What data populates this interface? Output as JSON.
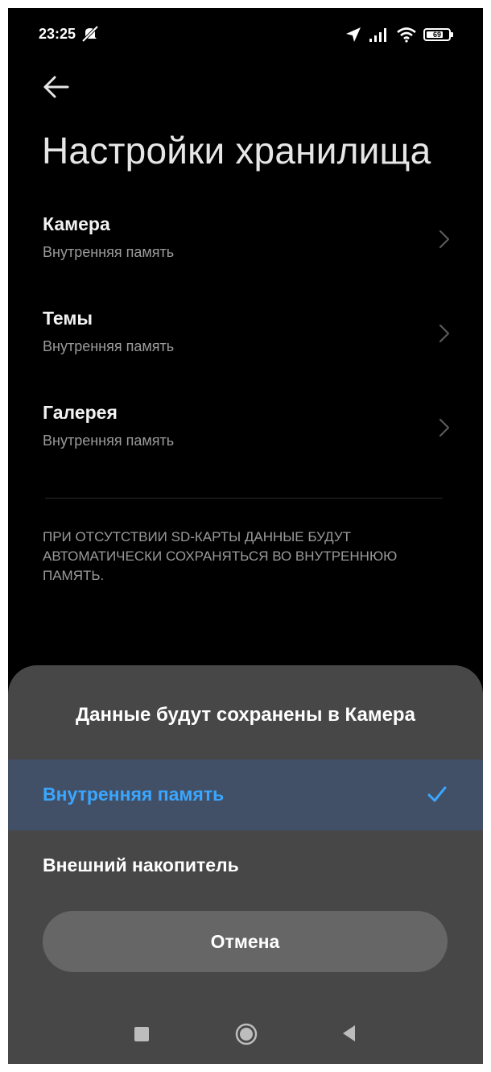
{
  "status_bar": {
    "time": "23:25",
    "battery": "69",
    "icons": [
      "mute-icon",
      "location-arrow-icon",
      "signal-icon",
      "wifi-icon",
      "battery-icon"
    ]
  },
  "header": {
    "back_icon": "arrow-left-icon",
    "title": "Настройки хранилища"
  },
  "settings": [
    {
      "label": "Камера",
      "value": "Внутренняя память"
    },
    {
      "label": "Темы",
      "value": "Внутренняя память"
    },
    {
      "label": "Галерея",
      "value": "Внутренняя память"
    }
  ],
  "note": "При отсутствии SD-карты данные будут автоматически сохраняться во внутреннюю память.",
  "sheet": {
    "title": "Данные будут сохранены в Камера",
    "options": [
      {
        "label": "Внутренняя память",
        "selected": true
      },
      {
        "label": "Внешний накопитель",
        "selected": false
      }
    ],
    "cancel_label": "Отмена"
  },
  "navigation": [
    "recents-square-icon",
    "home-circle-icon",
    "back-triangle-icon"
  ],
  "colors": {
    "background": "#000000",
    "sheet": "#474747",
    "selected_row": "#415066",
    "accent": "#3aa6ff",
    "cancel_button": "#666666"
  }
}
